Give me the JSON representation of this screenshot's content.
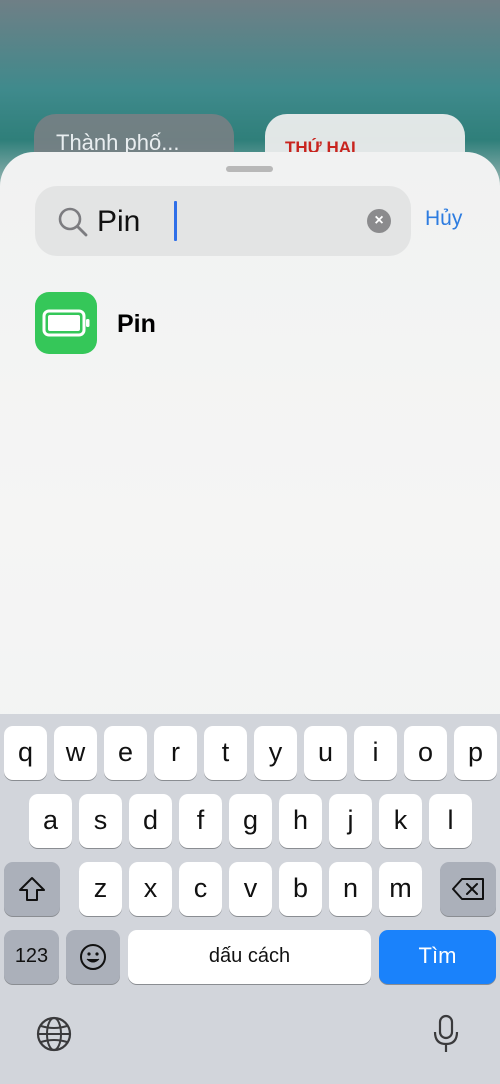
{
  "background": {
    "widget_left_label": "Thành phố...",
    "widget_right_label": "THỨ HAI"
  },
  "search": {
    "value": "Pin",
    "cancel_label": "Hủy",
    "clear_symbol": "×"
  },
  "results": [
    {
      "label": "Pin",
      "icon": "battery-icon",
      "icon_color": "#35c759"
    }
  ],
  "keyboard": {
    "row1": [
      "q",
      "w",
      "e",
      "r",
      "t",
      "y",
      "u",
      "i",
      "o",
      "p"
    ],
    "row2": [
      "a",
      "s",
      "d",
      "f",
      "g",
      "h",
      "j",
      "k",
      "l"
    ],
    "row3": [
      "z",
      "x",
      "c",
      "v",
      "b",
      "n",
      "m"
    ],
    "numbers_label": "123",
    "space_label": "dấu cách",
    "return_label": "Tìm",
    "accent_color": "#1a82fb"
  }
}
